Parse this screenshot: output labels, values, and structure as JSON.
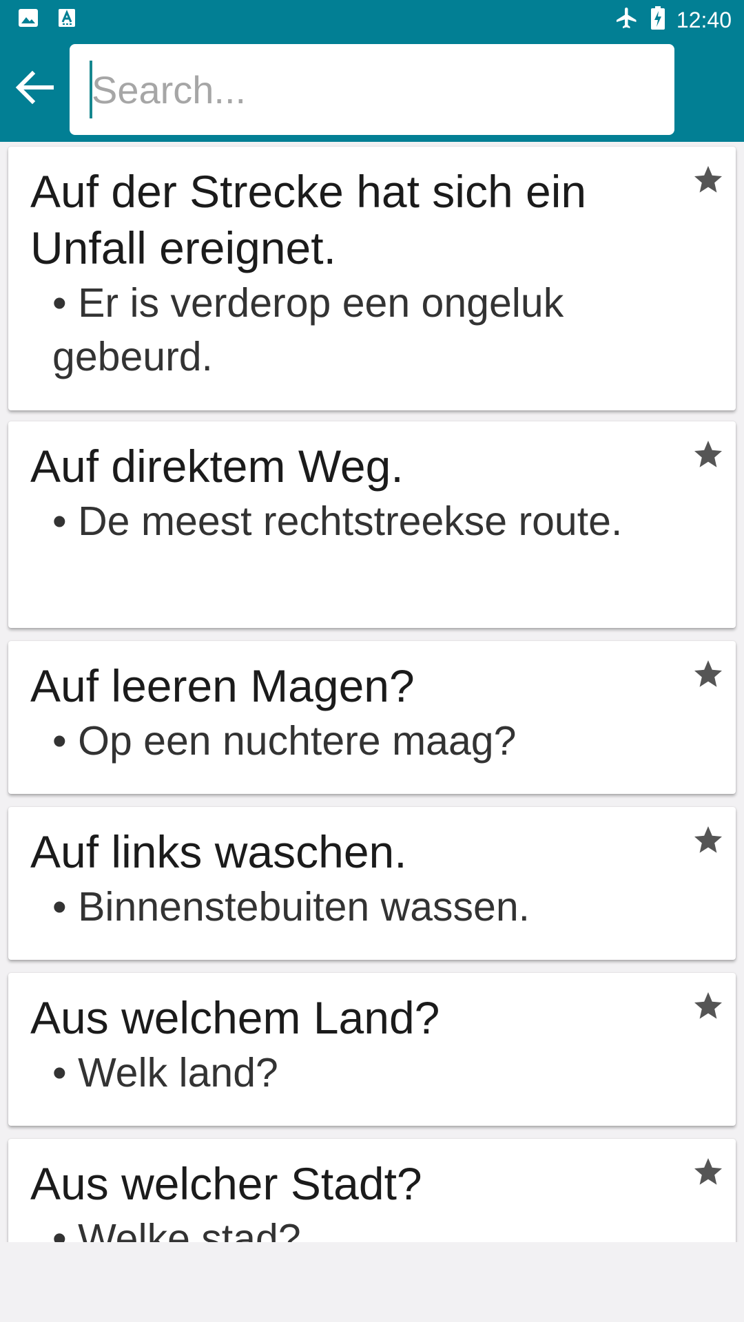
{
  "status_bar": {
    "time": "12:40",
    "icons": [
      "image-icon",
      "text-recognition-icon",
      "airplane-icon",
      "battery-charging-icon"
    ]
  },
  "toolbar": {
    "back_icon": "arrow-left-icon",
    "search_placeholder": "Search..."
  },
  "colors": {
    "app_bar": "#027f94",
    "background": "#f2f1f3",
    "star": "#555555"
  },
  "phrases": [
    {
      "german": "Auf der Strecke hat sich ein Unfall ereignet.",
      "dutch": "Er is verderop een ongeluk gebeurd.",
      "favorite_icon": "star-icon"
    },
    {
      "german": "Auf direktem Weg.",
      "dutch": "De meest rechtstreekse route.",
      "favorite_icon": "star-icon"
    },
    {
      "german": "Auf leeren Magen?",
      "dutch": "Op een nuchtere maag?",
      "favorite_icon": "star-icon"
    },
    {
      "german": "Auf links waschen.",
      "dutch": "Binnenstebuiten wassen.",
      "favorite_icon": "star-icon"
    },
    {
      "german": "Aus welchem Land?",
      "dutch": "Welk land?",
      "favorite_icon": "star-icon"
    },
    {
      "german": "Aus welcher Stadt?",
      "dutch": "Welke stad?",
      "favorite_icon": "star-icon"
    }
  ],
  "bullet": "• "
}
